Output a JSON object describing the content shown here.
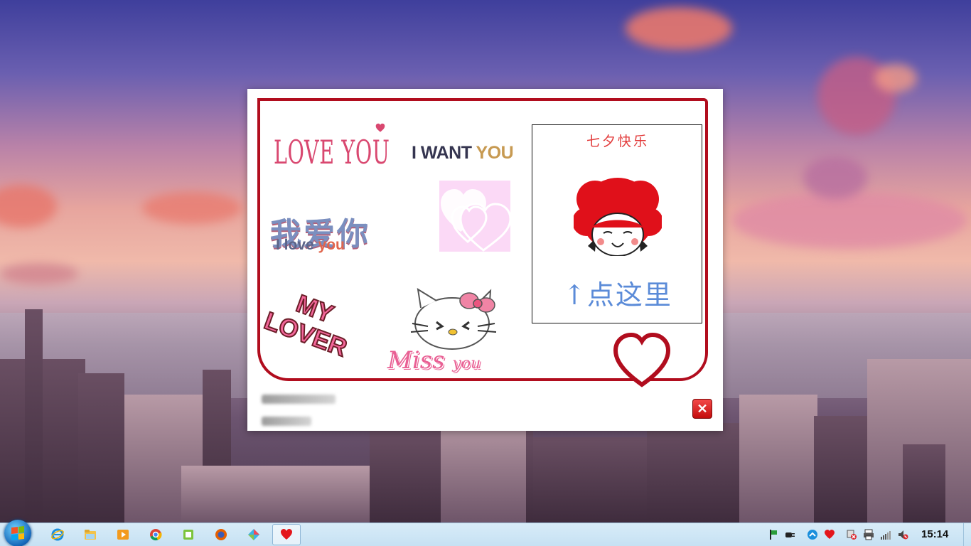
{
  "popup": {
    "stickers": {
      "love_you": "LOVE YOU",
      "i_want": "I WANT ",
      "you": "YOU",
      "wo_ai_ni": "我爱你",
      "i_love": "I love ",
      "i_love_you_you": "you",
      "my": "MY",
      "lover": "LOVER",
      "miss": "Miss ",
      "miss_you": "you"
    },
    "card": {
      "title": "七夕快乐",
      "hint": "↑点这里"
    },
    "close_label": "✕"
  },
  "taskbar": {
    "clock": "15:14",
    "apps": [
      "internet-explorer",
      "file-explorer",
      "media-player",
      "chrome",
      "green-app",
      "firefox",
      "gem-app",
      "heart-app"
    ],
    "tray": [
      "flag-icon",
      "power-plug-icon",
      "arrow-up-icon",
      "heart-icon",
      "network-icon",
      "printer-icon",
      "signal-icon",
      "volume-icon"
    ]
  },
  "colors": {
    "frame": "#b10d1e",
    "card_title": "#e23b3b",
    "card_hint": "#5b8bd8"
  }
}
